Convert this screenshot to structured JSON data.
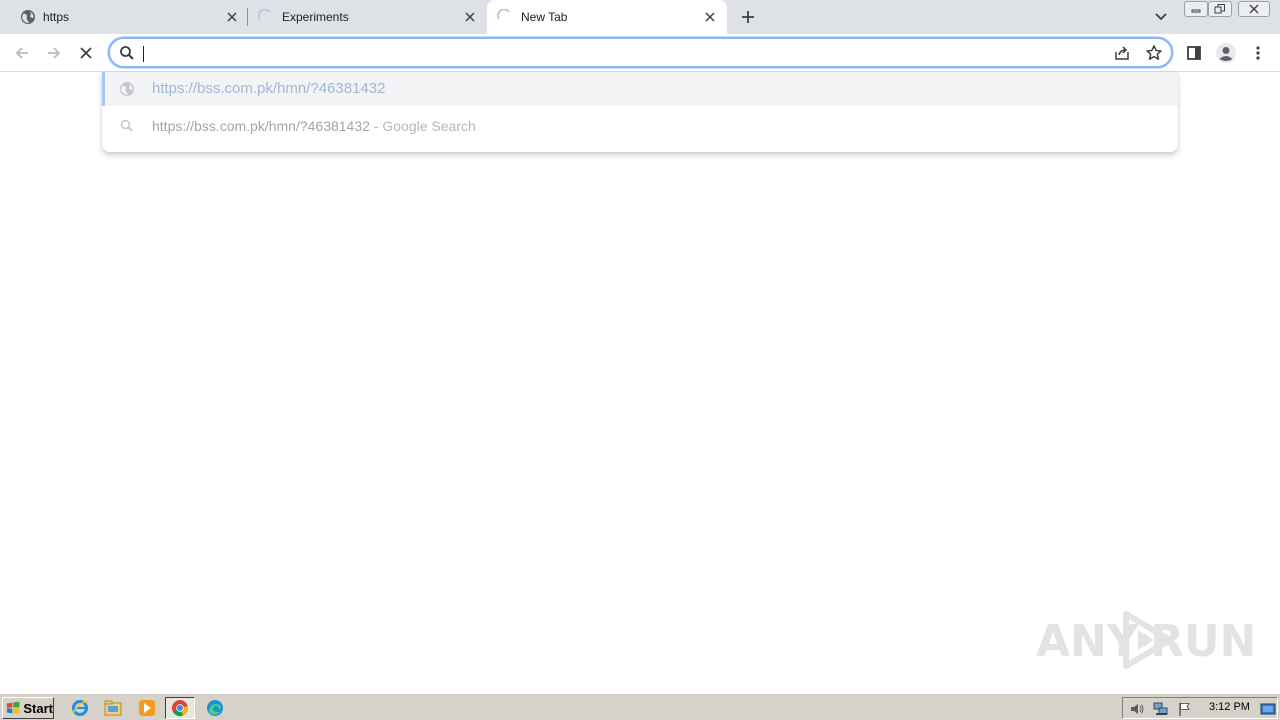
{
  "tabs": [
    {
      "title": "https",
      "favicon": "globe-icon"
    },
    {
      "title": "Experiments",
      "favicon": "loading-spinner-icon"
    },
    {
      "title": "New Tab",
      "favicon": "loading-spinner-icon"
    }
  ],
  "omnibox": {
    "value": "",
    "placeholder": ""
  },
  "suggestions": [
    {
      "text": "https://bss.com.pk/hmn/?46381432",
      "icon": "globe-icon",
      "selected": true
    },
    {
      "text": "https://bss.com.pk/hmn/?46381432",
      "dash": " - ",
      "hint": "Google Search",
      "icon": "search-icon",
      "selected": false
    }
  ],
  "watermark": {
    "left": "ANY",
    "right": "RUN"
  },
  "taskbar": {
    "start_label": "Start",
    "clock": "3:12 PM"
  },
  "colors": {
    "tabstrip": "#dee1e6",
    "omnibox_focus": "#8ab4f8",
    "suggestion_selected_text": "#a3b7d6",
    "taskbar": "#d6d2c9"
  }
}
